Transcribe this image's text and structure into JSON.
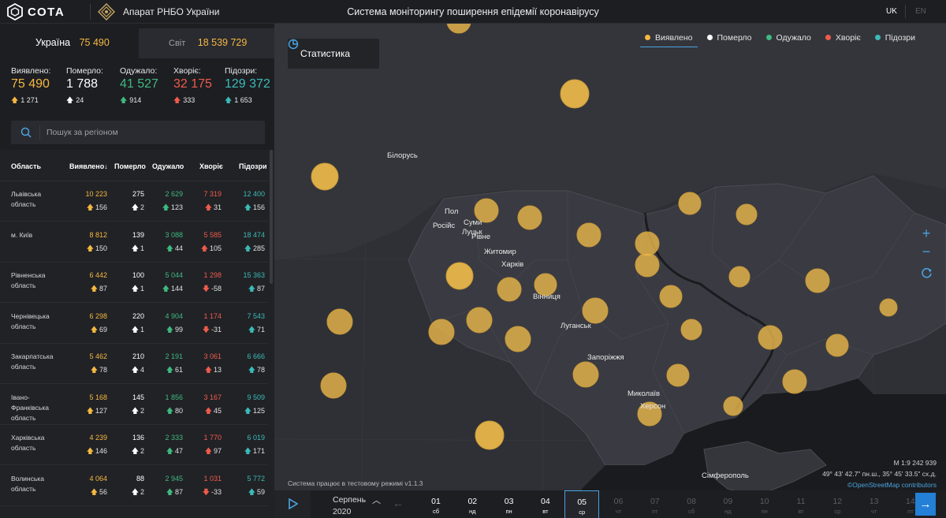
{
  "header": {
    "logo_text": "СОТА",
    "org_name": "Апарат РНБО України",
    "title": "Система моніторингу поширення епідемії коронавірусу",
    "lang_uk": "UK",
    "lang_en": "EN"
  },
  "tabs": {
    "ukraine_label": "Україна",
    "ukraine_value": "75 490",
    "world_label": "Світ",
    "world_value": "18 539 729"
  },
  "stats": [
    {
      "label": "Виявлено:",
      "value": "75 490",
      "delta": "1 271",
      "color": "yellow",
      "dir": "up"
    },
    {
      "label": "Померло:",
      "value": "1 788",
      "delta": "24",
      "color": "white",
      "dir": "up"
    },
    {
      "label": "Одужало:",
      "value": "41 527",
      "delta": "914",
      "color": "green",
      "dir": "up"
    },
    {
      "label": "Хворіє:",
      "value": "32 175",
      "delta": "333",
      "color": "red",
      "dir": "up"
    },
    {
      "label": "Підозри:",
      "value": "129 372",
      "delta": "1 653",
      "color": "teal",
      "dir": "up"
    }
  ],
  "search": {
    "placeholder": "Пошук за регіоном"
  },
  "table": {
    "headers": {
      "region": "Область",
      "detected": "Виявлено",
      "sort_arrow": "↓",
      "died": "Померло",
      "recovered": "Одужало",
      "sick": "Хворіє",
      "suspected": "Підозри"
    },
    "rows": [
      {
        "region": "Львівська область",
        "detected": "10 223",
        "detected_d": "156",
        "died": "275",
        "died_d": "2",
        "recovered": "2 629",
        "recovered_d": "123",
        "sick": "7 319",
        "sick_d": "31",
        "sick_dir": "up",
        "suspected": "12 400",
        "suspected_d": "156"
      },
      {
        "region": "м. Київ",
        "detected": "8 812",
        "detected_d": "150",
        "died": "139",
        "died_d": "1",
        "recovered": "3 088",
        "recovered_d": "44",
        "sick": "5 585",
        "sick_d": "105",
        "sick_dir": "up",
        "suspected": "18 474",
        "suspected_d": "285"
      },
      {
        "region": "Рівненська область",
        "detected": "6 442",
        "detected_d": "87",
        "died": "100",
        "died_d": "1",
        "recovered": "5 044",
        "recovered_d": "144",
        "sick": "1 298",
        "sick_d": "-58",
        "sick_dir": "down",
        "suspected": "15 363",
        "suspected_d": "87"
      },
      {
        "region": "Чернівецька область",
        "detected": "6 298",
        "detected_d": "69",
        "died": "220",
        "died_d": "1",
        "recovered": "4 904",
        "recovered_d": "99",
        "sick": "1 174",
        "sick_d": "-31",
        "sick_dir": "down",
        "suspected": "7 543",
        "suspected_d": "71"
      },
      {
        "region": "Закарпатська область",
        "detected": "5 462",
        "detected_d": "78",
        "died": "210",
        "died_d": "4",
        "recovered": "2 191",
        "recovered_d": "61",
        "sick": "3 061",
        "sick_d": "13",
        "sick_dir": "up",
        "suspected": "6 666",
        "suspected_d": "78"
      },
      {
        "region": "Івано-Франківська область",
        "detected": "5 168",
        "detected_d": "127",
        "died": "145",
        "died_d": "2",
        "recovered": "1 856",
        "recovered_d": "80",
        "sick": "3 167",
        "sick_d": "45",
        "sick_dir": "up",
        "suspected": "9 509",
        "suspected_d": "125"
      },
      {
        "region": "Харківська область",
        "detected": "4 239",
        "detected_d": "146",
        "died": "136",
        "died_d": "2",
        "recovered": "2 333",
        "recovered_d": "47",
        "sick": "1 770",
        "sick_d": "97",
        "sick_dir": "up",
        "suspected": "6 019",
        "suspected_d": "171"
      },
      {
        "region": "Волинська область",
        "detected": "4 064",
        "detected_d": "56",
        "died": "88",
        "died_d": "2",
        "recovered": "2 945",
        "recovered_d": "87",
        "sick": "1 031",
        "sick_d": "-33",
        "sick_dir": "down",
        "suspected": "5 772",
        "suspected_d": "59"
      }
    ]
  },
  "map": {
    "stats_button": "Статистика",
    "legend": [
      {
        "label": "Виявлено",
        "color": "#f5b841",
        "active": true
      },
      {
        "label": "Померло",
        "color": "#ffffff",
        "active": false
      },
      {
        "label": "Одужало",
        "color": "#3fb980",
        "active": false
      },
      {
        "label": "Хворіє",
        "color": "#ef5b4b",
        "active": false
      },
      {
        "label": "Підозри",
        "color": "#3bbab8",
        "active": false
      }
    ],
    "zoom_in": "+",
    "zoom_out": "−",
    "labels": {
      "belarus": "Білорусь",
      "pol": "Пол",
      "rosiis": "Російс",
      "sumy": "Суми",
      "lutsk": "Луцьк",
      "rivne": "Рівне",
      "zhytomyr": "Житомир",
      "kharkiv": "Харків",
      "vinnytsia": "Вінниця",
      "luhansk": "Луганськ",
      "zaporizhzhia": "Запоріжжя",
      "mykolaiv": "Миколаїв",
      "kherson": "Херсон",
      "simferopol": "Сімферополь"
    },
    "scale": "М 1:9 242 939",
    "coords": "49° 43' 42.7\" пн.ш., 35° 45' 33.5\" сх.д.",
    "attribution": "©OpenStreetMap contributors",
    "version": "Система працює в тестовому режимі v1.1.3",
    "bubble_color": "#e8b64a"
  },
  "timeline": {
    "month": "Серпень",
    "year": "2020",
    "days": [
      {
        "n": "01",
        "w": "сб",
        "state": "past"
      },
      {
        "n": "02",
        "w": "нд",
        "state": "past"
      },
      {
        "n": "03",
        "w": "пн",
        "state": "past"
      },
      {
        "n": "04",
        "w": "вт",
        "state": "past"
      },
      {
        "n": "05",
        "w": "ср",
        "state": "sel"
      },
      {
        "n": "06",
        "w": "чт",
        "state": "future"
      },
      {
        "n": "07",
        "w": "пт",
        "state": "future"
      },
      {
        "n": "08",
        "w": "сб",
        "state": "future"
      },
      {
        "n": "09",
        "w": "нд",
        "state": "future"
      },
      {
        "n": "10",
        "w": "пн",
        "state": "future"
      },
      {
        "n": "11",
        "w": "вт",
        "state": "future"
      },
      {
        "n": "12",
        "w": "ср",
        "state": "future"
      },
      {
        "n": "13",
        "w": "чт",
        "state": "future"
      },
      {
        "n": "14",
        "w": "пт",
        "state": "future"
      }
    ]
  }
}
